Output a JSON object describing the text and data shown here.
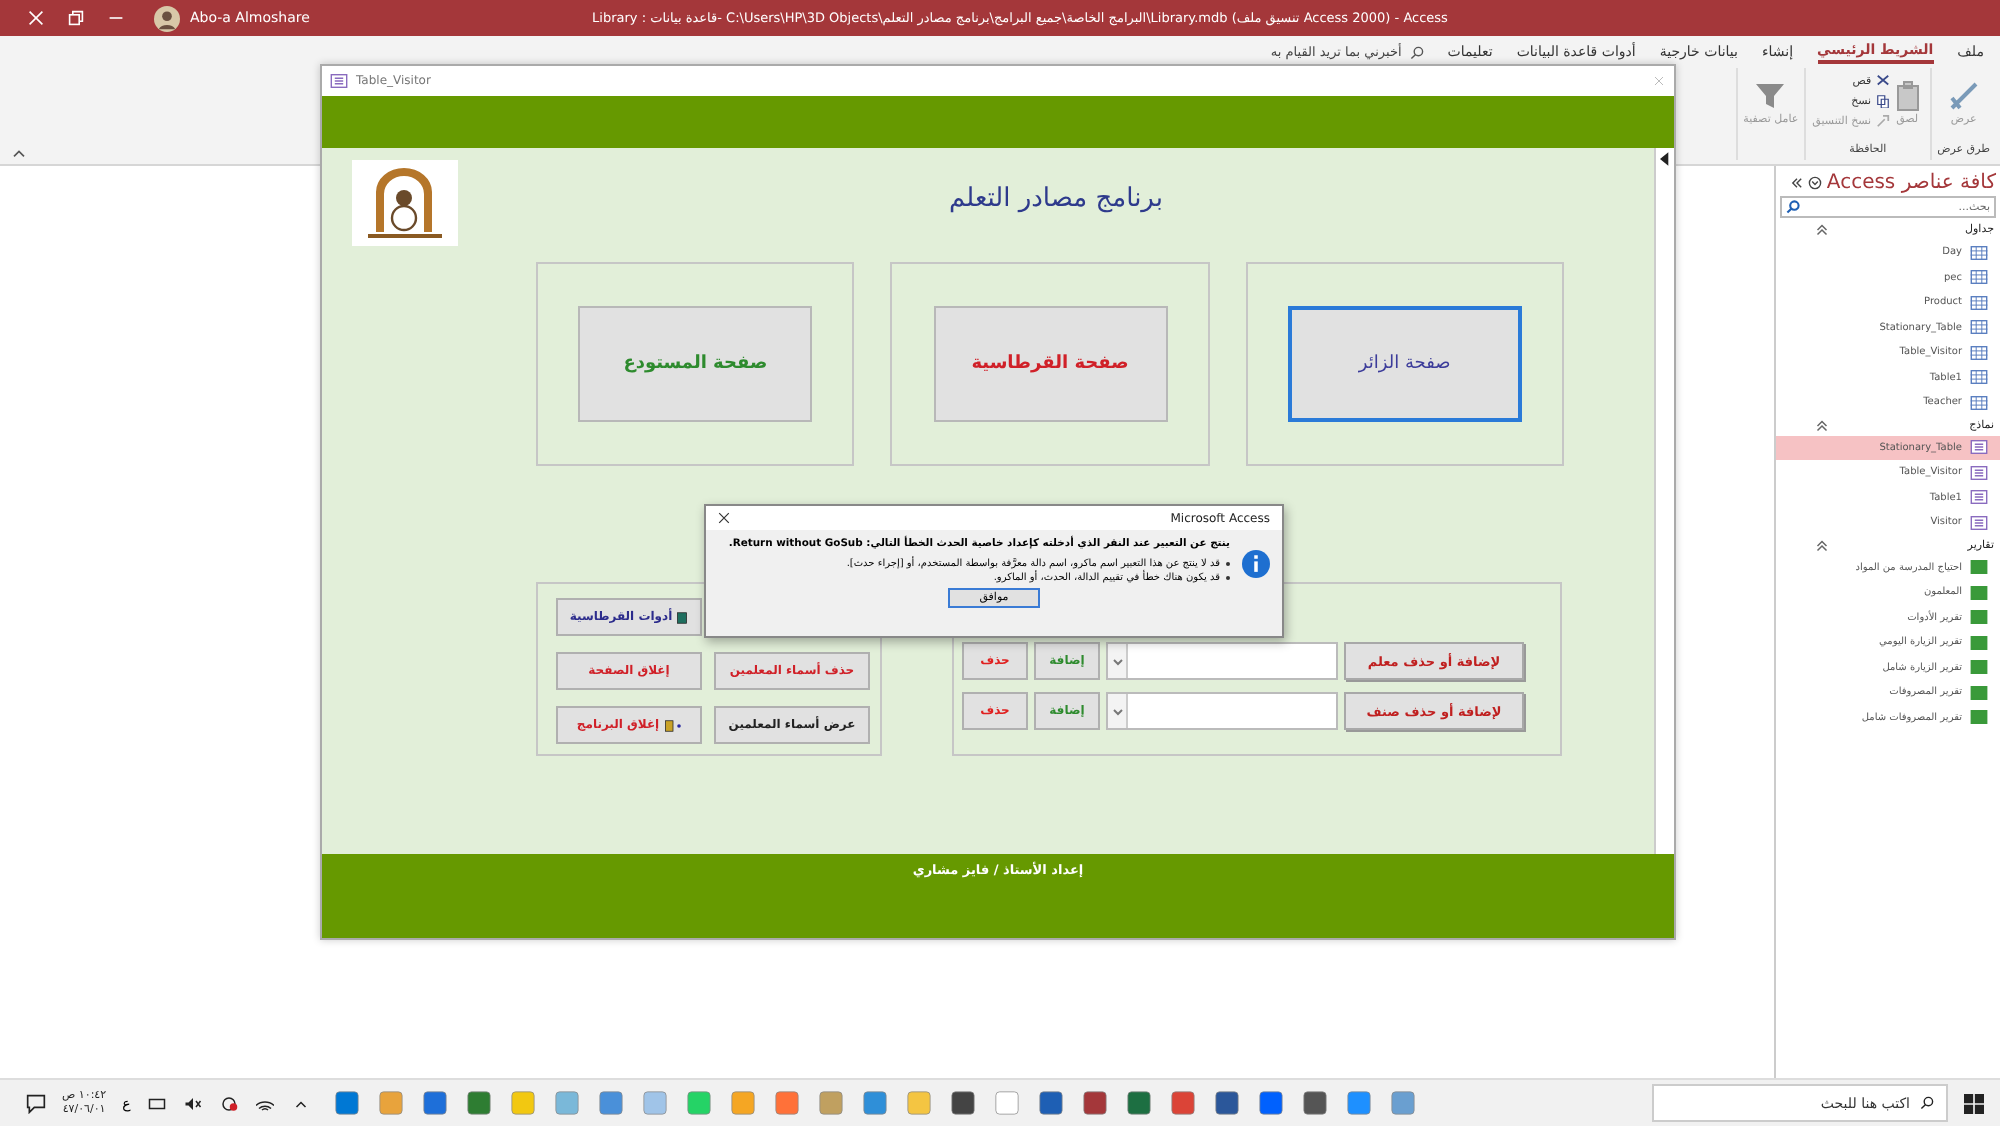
{
  "title_bar": {
    "user": "Abo-a Almoshare",
    "title": "Library : قاعدة بيانات- C:\\Users\\HP\\3D Objects\\البرامج الخاصة\\جميع البرامج\\برنامج مصادر التعلم\\Library.mdb (تنسيق ملف Access 2000) - Access"
  },
  "ribbon": {
    "tabs": [
      {
        "label": "ملف",
        "selected": false
      },
      {
        "label": "الشريط الرئيسي",
        "selected": true
      },
      {
        "label": "إنشاء",
        "selected": false
      },
      {
        "label": "بيانات خارجية",
        "selected": false
      },
      {
        "label": "أدوات قاعدة البيانات",
        "selected": false
      },
      {
        "label": "تعليمات",
        "selected": false
      }
    ],
    "tell_me": {
      "placeholder": "أخبرني بما تريد القيام به"
    },
    "groups": [
      {
        "label": "طرق عرض",
        "commands": [
          {
            "label": "عرض",
            "kind": "view",
            "disabled": true
          }
        ]
      },
      {
        "label": "الحافظة",
        "commands": [
          {
            "label": "لصق",
            "kind": "paste",
            "disabled": true
          },
          {
            "label": "قص",
            "kind": "cut",
            "disabled": false
          },
          {
            "label": "نسخ",
            "kind": "copy",
            "disabled": false
          },
          {
            "label": "نسخ التنسيق",
            "kind": "format",
            "disabled": true
          }
        ]
      },
      {
        "commands": [
          {
            "label": "عامل تصفية",
            "kind": "filter",
            "disabled": true
          }
        ]
      }
    ]
  },
  "form": {
    "title": "Table_Visitor",
    "heading": "برنامج مصادر التعلم",
    "pages": [
      {
        "label": "صفحة الزائر",
        "color": "#3c3c9a",
        "focused": true
      },
      {
        "label": "صفحة القرطاسية",
        "color": "#d02028",
        "focused": false
      },
      {
        "label": "صفحة المستودع",
        "color": "#2e8b2e",
        "focused": false
      }
    ],
    "button_columns": [
      [
        {
          "label": "حذف أسماء المعلمين",
          "color": "#d02028",
          "kind": "plain"
        },
        {
          "label": "عرض أسماء المعلمين",
          "color": "#222222",
          "kind": "plain"
        }
      ],
      [
        {
          "label": "أدوات القرطاسية",
          "color": "#2c2c8c",
          "kind": "open"
        },
        {
          "label": "إغلاق الصفحة",
          "color": "#d02028",
          "kind": "plain"
        },
        {
          "label": "إغلاق البرنامج",
          "color": "#d02028",
          "kind": "quit"
        }
      ]
    ],
    "edit_rows": [
      {
        "label": "لإضافة أو حذف معلم",
        "add": "إضافة",
        "delete": "حذف"
      },
      {
        "label": "لإضافة أو حذف صنف",
        "add": "إضافة",
        "delete": "حذف"
      }
    ],
    "footer": "إعداد الأستاذ / فايز مشاري"
  },
  "dialog": {
    "title": "Microsoft Access",
    "message": "ينتج عن التعبير عند النقر الذي أدخلته كإعداد خاصية الحدث الخطأ التالي: Return without GoSub.",
    "bullets": [
      "قد لا ينتج عن هذا التعبير اسم ماكرو، اسم دالة معرَّفة بواسطة المستخدم، أو [إجراء حدث].",
      "قد يكون هناك خطأ في تقييم الدالة، الحدث، أو الماكرو."
    ],
    "button": "موافق"
  },
  "nav": {
    "title": "كافة عناصر Access",
    "search": {
      "placeholder": "بحث..."
    },
    "groups": [
      {
        "label": "جداول",
        "kind": "table",
        "expanded": true,
        "items": [
          {
            "label": "Day",
            "selected": false
          },
          {
            "label": "pec",
            "selected": false
          },
          {
            "label": "Product",
            "selected": false
          },
          {
            "label": "Stationary_Table",
            "selected": false
          },
          {
            "label": "Table_Visitor",
            "selected": false
          },
          {
            "label": "Table1",
            "selected": false
          },
          {
            "label": "Teacher",
            "selected": false
          }
        ]
      },
      {
        "label": "نماذج",
        "kind": "form",
        "expanded": true,
        "items": [
          {
            "label": "Stationary_Table",
            "selected": true
          },
          {
            "label": "Table_Visitor",
            "selected": false
          },
          {
            "label": "Table1",
            "selected": false
          },
          {
            "label": "Visitor",
            "selected": false
          }
        ]
      },
      {
        "label": "تقارير",
        "kind": "report",
        "expanded": true,
        "items": [
          {
            "label": "احتياج المدرسة من المواد",
            "selected": false
          },
          {
            "label": "المعلمون",
            "selected": false
          },
          {
            "label": "تقرير الأدوات",
            "selected": false
          },
          {
            "label": "تقرير الزيارة اليومي",
            "selected": false
          },
          {
            "label": "تقرير الزيارة شامل",
            "selected": false
          },
          {
            "label": "تقرير المصروفات",
            "selected": false
          },
          {
            "label": "تقرير المصروفات شامل",
            "selected": false
          }
        ]
      }
    ]
  },
  "taskbar": {
    "search": {
      "placeholder": "اكتب هنا للبحث"
    },
    "language": "ع",
    "clock": {
      "time": "١٠:٤٢ ص",
      "date": "٤٧/٠٦/٠١"
    }
  }
}
